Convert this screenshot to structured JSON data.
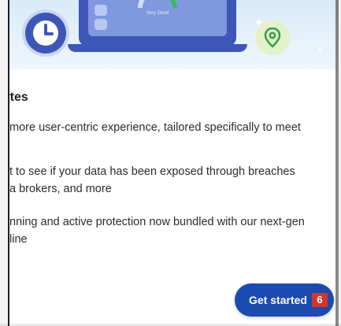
{
  "banner": {
    "gauge_label": "Very Good",
    "icons": [
      "clock-icon",
      "laptop-icon",
      "location-pin-icon"
    ]
  },
  "content": {
    "title": "bytes",
    "description": "more user-centric experience, tailored specifically to meet",
    "features": [
      {
        "line1": "t to see if your data has been exposed through breaches",
        "line2": "a brokers, and more"
      },
      {
        "line1": "nning and active protection now bundled with our next-gen",
        "line2": "line"
      }
    ]
  },
  "cta": {
    "label": "Get started",
    "badge": "6"
  },
  "colors": {
    "accent": "#1b4ab0",
    "badge": "#d3362d",
    "illustration_blue": "#3e56b8",
    "pin_green": "#2e9e4a"
  }
}
